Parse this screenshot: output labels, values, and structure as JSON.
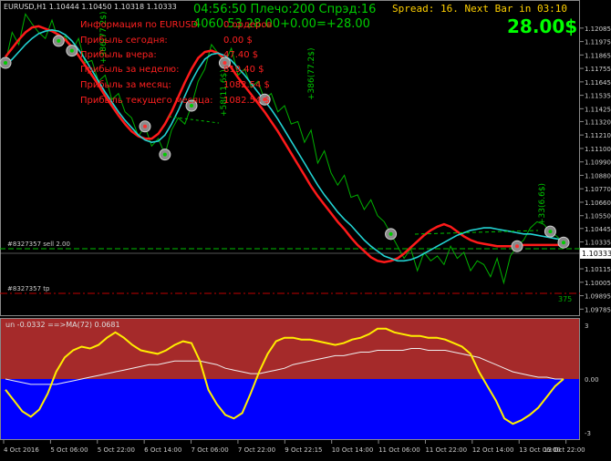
{
  "symbol_header": "EURUSD,H1  1.10444 1.10450 1.10318 1.10333",
  "top_center": {
    "line1": "04:56:50 Плечо:200 Спрэд:16",
    "line2": "4060.53 28.00+0.00=+28.00"
  },
  "top_right": {
    "spread_text": "Spread: 16. Next Bar in 03:10",
    "profit_big": "28.00$"
  },
  "info_panel": [
    {
      "label": "Информация по EURUSD",
      "value": "0 ордеров"
    },
    {
      "label": "Прибыль сегодня:",
      "value": "0.00 $"
    },
    {
      "label": "Прибыль вчера:",
      "value": "47.40 $"
    },
    {
      "label": "Прибыль за неделю:",
      "value": "819.40 $"
    },
    {
      "label": "Прибыль за месяц:",
      "value": "1082.54 $"
    },
    {
      "label": "Прибыль текущего месяца:",
      "value": "1082.54 $"
    }
  ],
  "order_lines": {
    "sell": "#8327357 sell 2.00",
    "tp": "#8327357 tp"
  },
  "trade_labels": [
    "+386(77.2$)",
    "+33(6.6$)",
    "+58(11.6$)",
    "+386(77.2$)"
  ],
  "tp_right_label": "375",
  "price_badge": "1.10333",
  "indicator_header": "un -0.0332  ==>MA(72) 0.0681",
  "colors": {
    "background": "#000000",
    "price": "#00b000",
    "ma_fast": "#22d3d3",
    "ma_slow": "#ff1a1a",
    "osc": "#ffee00",
    "osc_ma": "#f0f0f0",
    "osc_pos_bg": "#a52a2a",
    "osc_neg_bg": "#0000ff",
    "sell_line": "#00c000",
    "tp_line": "#c00000",
    "info_text": "#ff2020",
    "top_text": "#00cc00",
    "spread_text": "#ffd000"
  },
  "chart_data": [
    {
      "type": "line",
      "title": "EURUSD,H1",
      "yticks": [
        "1.12085",
        "1.11975",
        "1.11865",
        "1.11755",
        "1.11645",
        "1.11535",
        "1.11425",
        "1.11320",
        "1.11210",
        "1.11100",
        "1.10990",
        "1.10880",
        "1.10770",
        "1.10660",
        "1.10550",
        "1.10445",
        "1.10335",
        "1.10225",
        "1.10115",
        "1.10005",
        "1.09895",
        "1.09785"
      ],
      "xticks": [
        "4 Oct 2016",
        "5 Oct 06:00",
        "5 Oct 22:00",
        "6 Oct 14:00",
        "7 Oct 06:00",
        "7 Oct 22:00",
        "9 Oct 22:15",
        "10 Oct 14:00",
        "11 Oct 06:00",
        "11 Oct 22:00",
        "12 Oct 14:00",
        "13 Oct 06:00",
        "13 Oct 22:00"
      ],
      "ylim": [
        1.0975,
        1.123
      ],
      "series": [
        {
          "values": [
            1.118,
            1.1205,
            1.1195,
            1.122,
            1.1212,
            1.1205,
            1.12,
            1.1215,
            1.1198,
            1.1202,
            1.119,
            1.12,
            1.118,
            1.1182,
            1.1165,
            1.117,
            1.115,
            1.1155,
            1.114,
            1.1135,
            1.112,
            1.1128,
            1.1112,
            1.1118,
            1.1105,
            1.1125,
            1.1135,
            1.113,
            1.1145,
            1.1165,
            1.1175,
            1.1195,
            1.1188,
            1.118,
            1.1192,
            1.117,
            1.1175,
            1.116,
            1.1165,
            1.115,
            1.1155,
            1.114,
            1.1145,
            1.113,
            1.1132,
            1.1115,
            1.1125,
            1.1098,
            1.1108,
            1.109,
            1.108,
            1.1088,
            1.107,
            1.1072,
            1.106,
            1.1068,
            1.1055,
            1.105,
            1.104,
            1.103,
            1.102,
            1.1028,
            1.101,
            1.1025,
            1.1018,
            1.1022,
            1.1015,
            1.103,
            1.102,
            1.1025,
            1.101,
            1.1018,
            1.1015,
            1.1005,
            1.102,
            1.1,
            1.1022,
            1.103,
            1.1035,
            1.1045,
            1.105,
            1.1048,
            1.1042,
            1.1038,
            1.1033
          ]
        },
        {
          "values": [
            1.1185,
            1.1192,
            1.1199,
            1.1205,
            1.1209,
            1.121,
            1.1208,
            1.1206,
            1.1203,
            1.1199,
            1.1193,
            1.1186,
            1.1178,
            1.117,
            1.1162,
            1.1153,
            1.1145,
            1.1137,
            1.113,
            1.1124,
            1.112,
            1.1118,
            1.1118,
            1.1122,
            1.113,
            1.114,
            1.1152,
            1.1164,
            1.1175,
            1.1184,
            1.1189,
            1.119,
            1.1188,
            1.1183,
            1.1176,
            1.1168,
            1.1161,
            1.1154,
            1.1147,
            1.114,
            1.1132,
            1.1124,
            1.1115,
            1.1106,
            1.1097,
            1.1088,
            1.1079,
            1.1071,
            1.1064,
            1.1057,
            1.105,
            1.1044,
            1.1037,
            1.1031,
            1.1026,
            1.1021,
            1.1018,
            1.1017,
            1.1018,
            1.102,
            1.1024,
            1.1029,
            1.1034,
            1.1039,
            1.1043,
            1.1046,
            1.1048,
            1.1046,
            1.1042,
            1.1038,
            1.1035,
            1.1033,
            1.1032,
            1.1031,
            1.103,
            1.103,
            1.103,
            1.103,
            1.1031,
            1.1031,
            1.1031,
            1.1031,
            1.1031,
            1.1031,
            1.1031
          ]
        },
        {
          "values": [
            1.1178,
            1.1183,
            1.1189,
            1.1195,
            1.12,
            1.1204,
            1.1206,
            1.1207,
            1.1206,
            1.1203,
            1.1198,
            1.1191,
            1.1183,
            1.1174,
            1.1165,
            1.1156,
            1.1148,
            1.114,
            1.1133,
            1.1127,
            1.1121,
            1.1117,
            1.1115,
            1.1116,
            1.1121,
            1.113,
            1.1141,
            1.1153,
            1.1165,
            1.1175,
            1.1183,
            1.1187,
            1.1188,
            1.1186,
            1.1182,
            1.1176,
            1.117,
            1.1163,
            1.1156,
            1.1149,
            1.1142,
            1.1134,
            1.1125,
            1.1116,
            1.1107,
            1.1098,
            1.1089,
            1.108,
            1.1072,
            1.1065,
            1.1058,
            1.1052,
            1.1047,
            1.1041,
            1.1035,
            1.103,
            1.1026,
            1.1022,
            1.102,
            1.1018,
            1.1018,
            1.1019,
            1.1021,
            1.1024,
            1.1027,
            1.103,
            1.1033,
            1.1036,
            1.1039,
            1.1041,
            1.1043,
            1.1044,
            1.1045,
            1.1045,
            1.1044,
            1.1043,
            1.1042,
            1.1041,
            1.104,
            1.104,
            1.1039,
            1.1038,
            1.1037,
            1.1036,
            1.1035
          ]
        }
      ]
    },
    {
      "type": "area",
      "title": "un -0.0332  ==>MA(72) 0.0681",
      "yticks": [
        "3",
        "0.00",
        "-3"
      ],
      "ylim": [
        -3.3,
        3.3
      ],
      "series": [
        {
          "values": [
            -0.6,
            -1.2,
            -1.8,
            -2.1,
            -1.7,
            -0.8,
            0.4,
            1.2,
            1.6,
            1.8,
            1.7,
            1.9,
            2.3,
            2.6,
            2.3,
            1.9,
            1.6,
            1.5,
            1.4,
            1.6,
            1.9,
            2.1,
            2.0,
            1.0,
            -0.6,
            -1.4,
            -2.0,
            -2.2,
            -1.9,
            -0.8,
            0.4,
            1.4,
            2.1,
            2.3,
            2.3,
            2.2,
            2.2,
            2.1,
            2.0,
            1.9,
            2.0,
            2.2,
            2.3,
            2.5,
            2.8,
            2.8,
            2.6,
            2.5,
            2.4,
            2.4,
            2.3,
            2.3,
            2.2,
            2.0,
            1.8,
            1.4,
            0.4,
            -0.4,
            -1.2,
            -2.2,
            -2.5,
            -2.3,
            -2.0,
            -1.6,
            -1.0,
            -0.4,
            0.0
          ]
        },
        {
          "values": [
            0.0,
            -0.1,
            -0.2,
            -0.3,
            -0.3,
            -0.3,
            -0.3,
            -0.2,
            -0.1,
            0.0,
            0.1,
            0.2,
            0.3,
            0.4,
            0.5,
            0.6,
            0.7,
            0.8,
            0.8,
            0.9,
            1.0,
            1.0,
            1.0,
            1.0,
            0.9,
            0.8,
            0.6,
            0.5,
            0.4,
            0.3,
            0.3,
            0.4,
            0.5,
            0.6,
            0.8,
            0.9,
            1.0,
            1.1,
            1.2,
            1.3,
            1.3,
            1.4,
            1.5,
            1.5,
            1.6,
            1.6,
            1.6,
            1.6,
            1.7,
            1.7,
            1.6,
            1.6,
            1.6,
            1.5,
            1.4,
            1.3,
            1.2,
            1.0,
            0.8,
            0.6,
            0.4,
            0.3,
            0.2,
            0.1,
            0.1,
            0.0,
            0.0
          ]
        }
      ]
    }
  ]
}
